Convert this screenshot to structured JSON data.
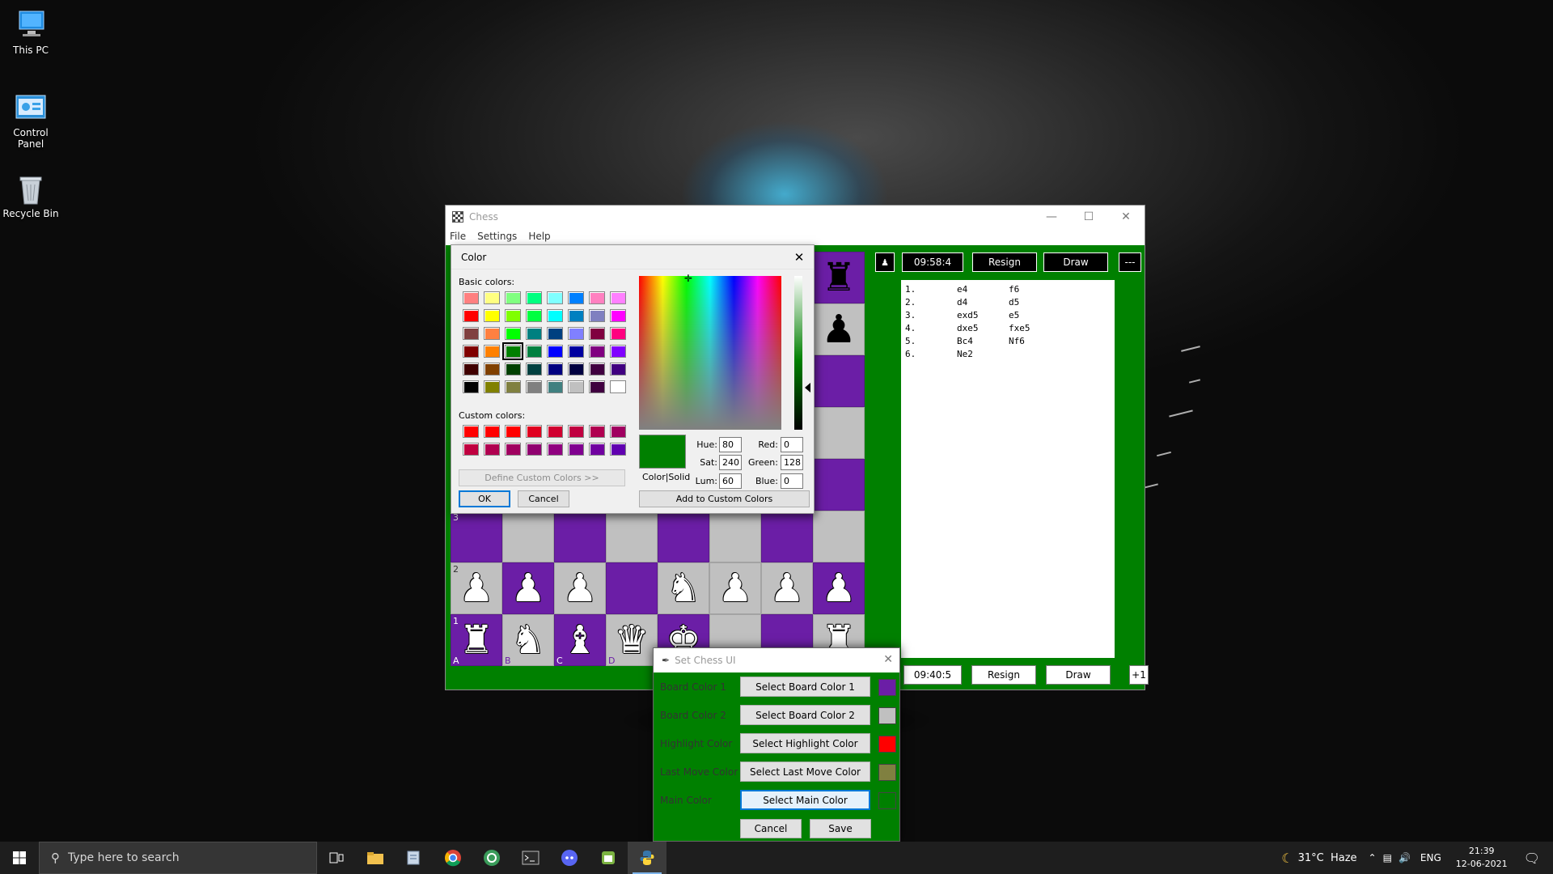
{
  "desktop": {
    "icons": [
      {
        "label": "This PC",
        "icon": "computer-icon"
      },
      {
        "label": "Control Panel",
        "icon": "control-panel-icon"
      },
      {
        "label": "Recycle Bin",
        "icon": "recycle-bin-icon"
      }
    ]
  },
  "chess_window": {
    "title": "Chess",
    "menu": [
      "File",
      "Settings",
      "Help"
    ],
    "board": {
      "rank_labels": [
        "3",
        "2",
        "1"
      ],
      "file_labels": [
        "A",
        "B",
        "C",
        "D"
      ]
    },
    "top_player": {
      "timer": "09:58:4",
      "resign": "Resign",
      "draw": "Draw",
      "extra": "---"
    },
    "bottom_player": {
      "timer": "09:40:5",
      "resign": "Resign",
      "draw": "Draw",
      "extra": "+1"
    },
    "moves": [
      {
        "n": "1.",
        "w": "e4",
        "b": "f6"
      },
      {
        "n": "2.",
        "w": "d4",
        "b": "d5"
      },
      {
        "n": "3.",
        "w": "exd5",
        "b": "e5"
      },
      {
        "n": "4.",
        "w": "dxe5",
        "b": "fxe5"
      },
      {
        "n": "5.",
        "w": "Bc4",
        "b": "Nf6"
      },
      {
        "n": "6.",
        "w": "Ne2",
        "b": ""
      }
    ]
  },
  "color_dialog": {
    "title": "Color",
    "basic_colors_label": "Basic colors:",
    "custom_colors_label": "Custom colors:",
    "define_custom": "Define Custom Colors >>",
    "ok": "OK",
    "cancel": "Cancel",
    "color_solid": "Color|Solid",
    "add_custom": "Add to Custom Colors",
    "hue_label": "Hue:",
    "hue": "80",
    "sat_label": "Sat:",
    "sat": "240",
    "lum_label": "Lum:",
    "lum": "60",
    "red_label": "Red:",
    "red": "0",
    "green_label": "Green:",
    "green": "128",
    "blue_label": "Blue:",
    "blue": "0",
    "current_color": "#008000",
    "basic_colors": [
      "#ff8080",
      "#ffff80",
      "#80ff80",
      "#00ff80",
      "#80ffff",
      "#0080ff",
      "#ff80c0",
      "#ff80ff",
      "#ff0000",
      "#ffff00",
      "#80ff00",
      "#00ff40",
      "#00ffff",
      "#0080c0",
      "#8080c0",
      "#ff00ff",
      "#804040",
      "#ff8040",
      "#00ff00",
      "#008080",
      "#004080",
      "#8080ff",
      "#800040",
      "#ff0080",
      "#800000",
      "#ff8000",
      "#008000",
      "#008040",
      "#0000ff",
      "#0000a0",
      "#800080",
      "#8000ff",
      "#400000",
      "#804000",
      "#004000",
      "#004040",
      "#000080",
      "#000040",
      "#400040",
      "#400080",
      "#000000",
      "#808000",
      "#808040",
      "#808080",
      "#408080",
      "#c0c0c0",
      "#400040",
      "#ffffff"
    ],
    "custom_colors": [
      "#ff0000",
      "#ff0000",
      "#ff0000",
      "#e00020",
      "#d00030",
      "#c00040",
      "#b00050",
      "#a00060",
      "#c00040",
      "#b00050",
      "#a00060",
      "#900070",
      "#900080",
      "#800090",
      "#7000a0",
      "#6000b0"
    ]
  },
  "ui_dialog": {
    "title": "Set Chess UI",
    "rows": [
      {
        "label": "Board Color 1",
        "button": "Select Board Color 1",
        "color": "#6b1ea6"
      },
      {
        "label": "Board Color 2",
        "button": "Select Board Color 2",
        "color": "#c0c0c0"
      },
      {
        "label": "Highlight Color",
        "button": "Select Highlight Color",
        "color": "#ff0000"
      },
      {
        "label": "Last Move Color",
        "button": "Select Last Move Color",
        "color": "#808040"
      },
      {
        "label": "Main Color",
        "button": "Select Main Color",
        "color": "#008000"
      }
    ],
    "cancel": "Cancel",
    "save": "Save"
  },
  "taskbar": {
    "search_placeholder": "Type here to search",
    "apps": [
      "task-view-icon",
      "file-explorer-icon",
      "notepad-icon",
      "chrome-icon",
      "app-icon",
      "terminal-icon",
      "discord-icon",
      "android-icon",
      "python-icon"
    ],
    "weather": "31°C  Haze",
    "language": "ENG",
    "time": "21:39",
    "date": "12-06-2021"
  }
}
